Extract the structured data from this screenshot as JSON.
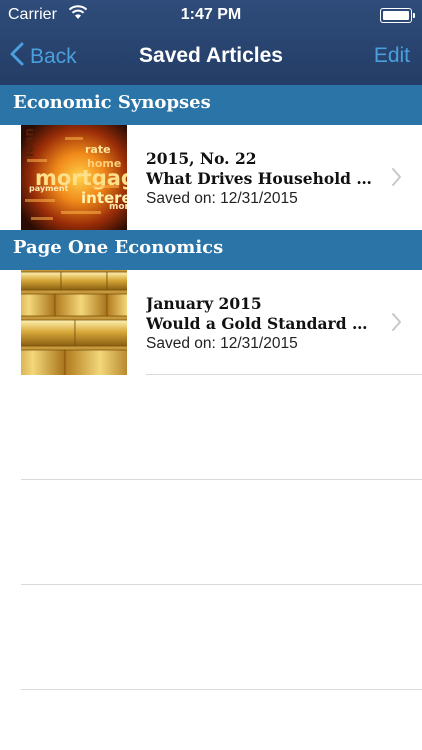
{
  "status_bar": {
    "carrier": "Carrier",
    "time": "1:47 PM",
    "wifi_icon": "wifi-icon",
    "battery_icon": "battery-icon"
  },
  "nav": {
    "back_label": "Back",
    "title": "Saved Articles",
    "edit_label": "Edit"
  },
  "colors": {
    "nav_bg": "#2a4470",
    "link": "#4aa0dd",
    "section_bg": "#2a74a7"
  },
  "sections": [
    {
      "header": "Economic Synopses",
      "articles": [
        {
          "issue": "2015, No. 22",
          "headline": "What Drives Household Debt?",
          "saved": "Saved on: 12/31/2015",
          "thumbnail": "mortgage word-cloud image",
          "thumbnail_words": [
            "loan",
            "mortgage",
            "interest",
            "payment",
            "rate",
            "home",
            "mon"
          ]
        }
      ]
    },
    {
      "header": "Page One Economics",
      "articles": [
        {
          "issue": "January 2015",
          "headline": "Would a Gold Standard Work?",
          "saved": "Saved on: 12/31/2015",
          "thumbnail": "gold bars image"
        }
      ]
    }
  ]
}
